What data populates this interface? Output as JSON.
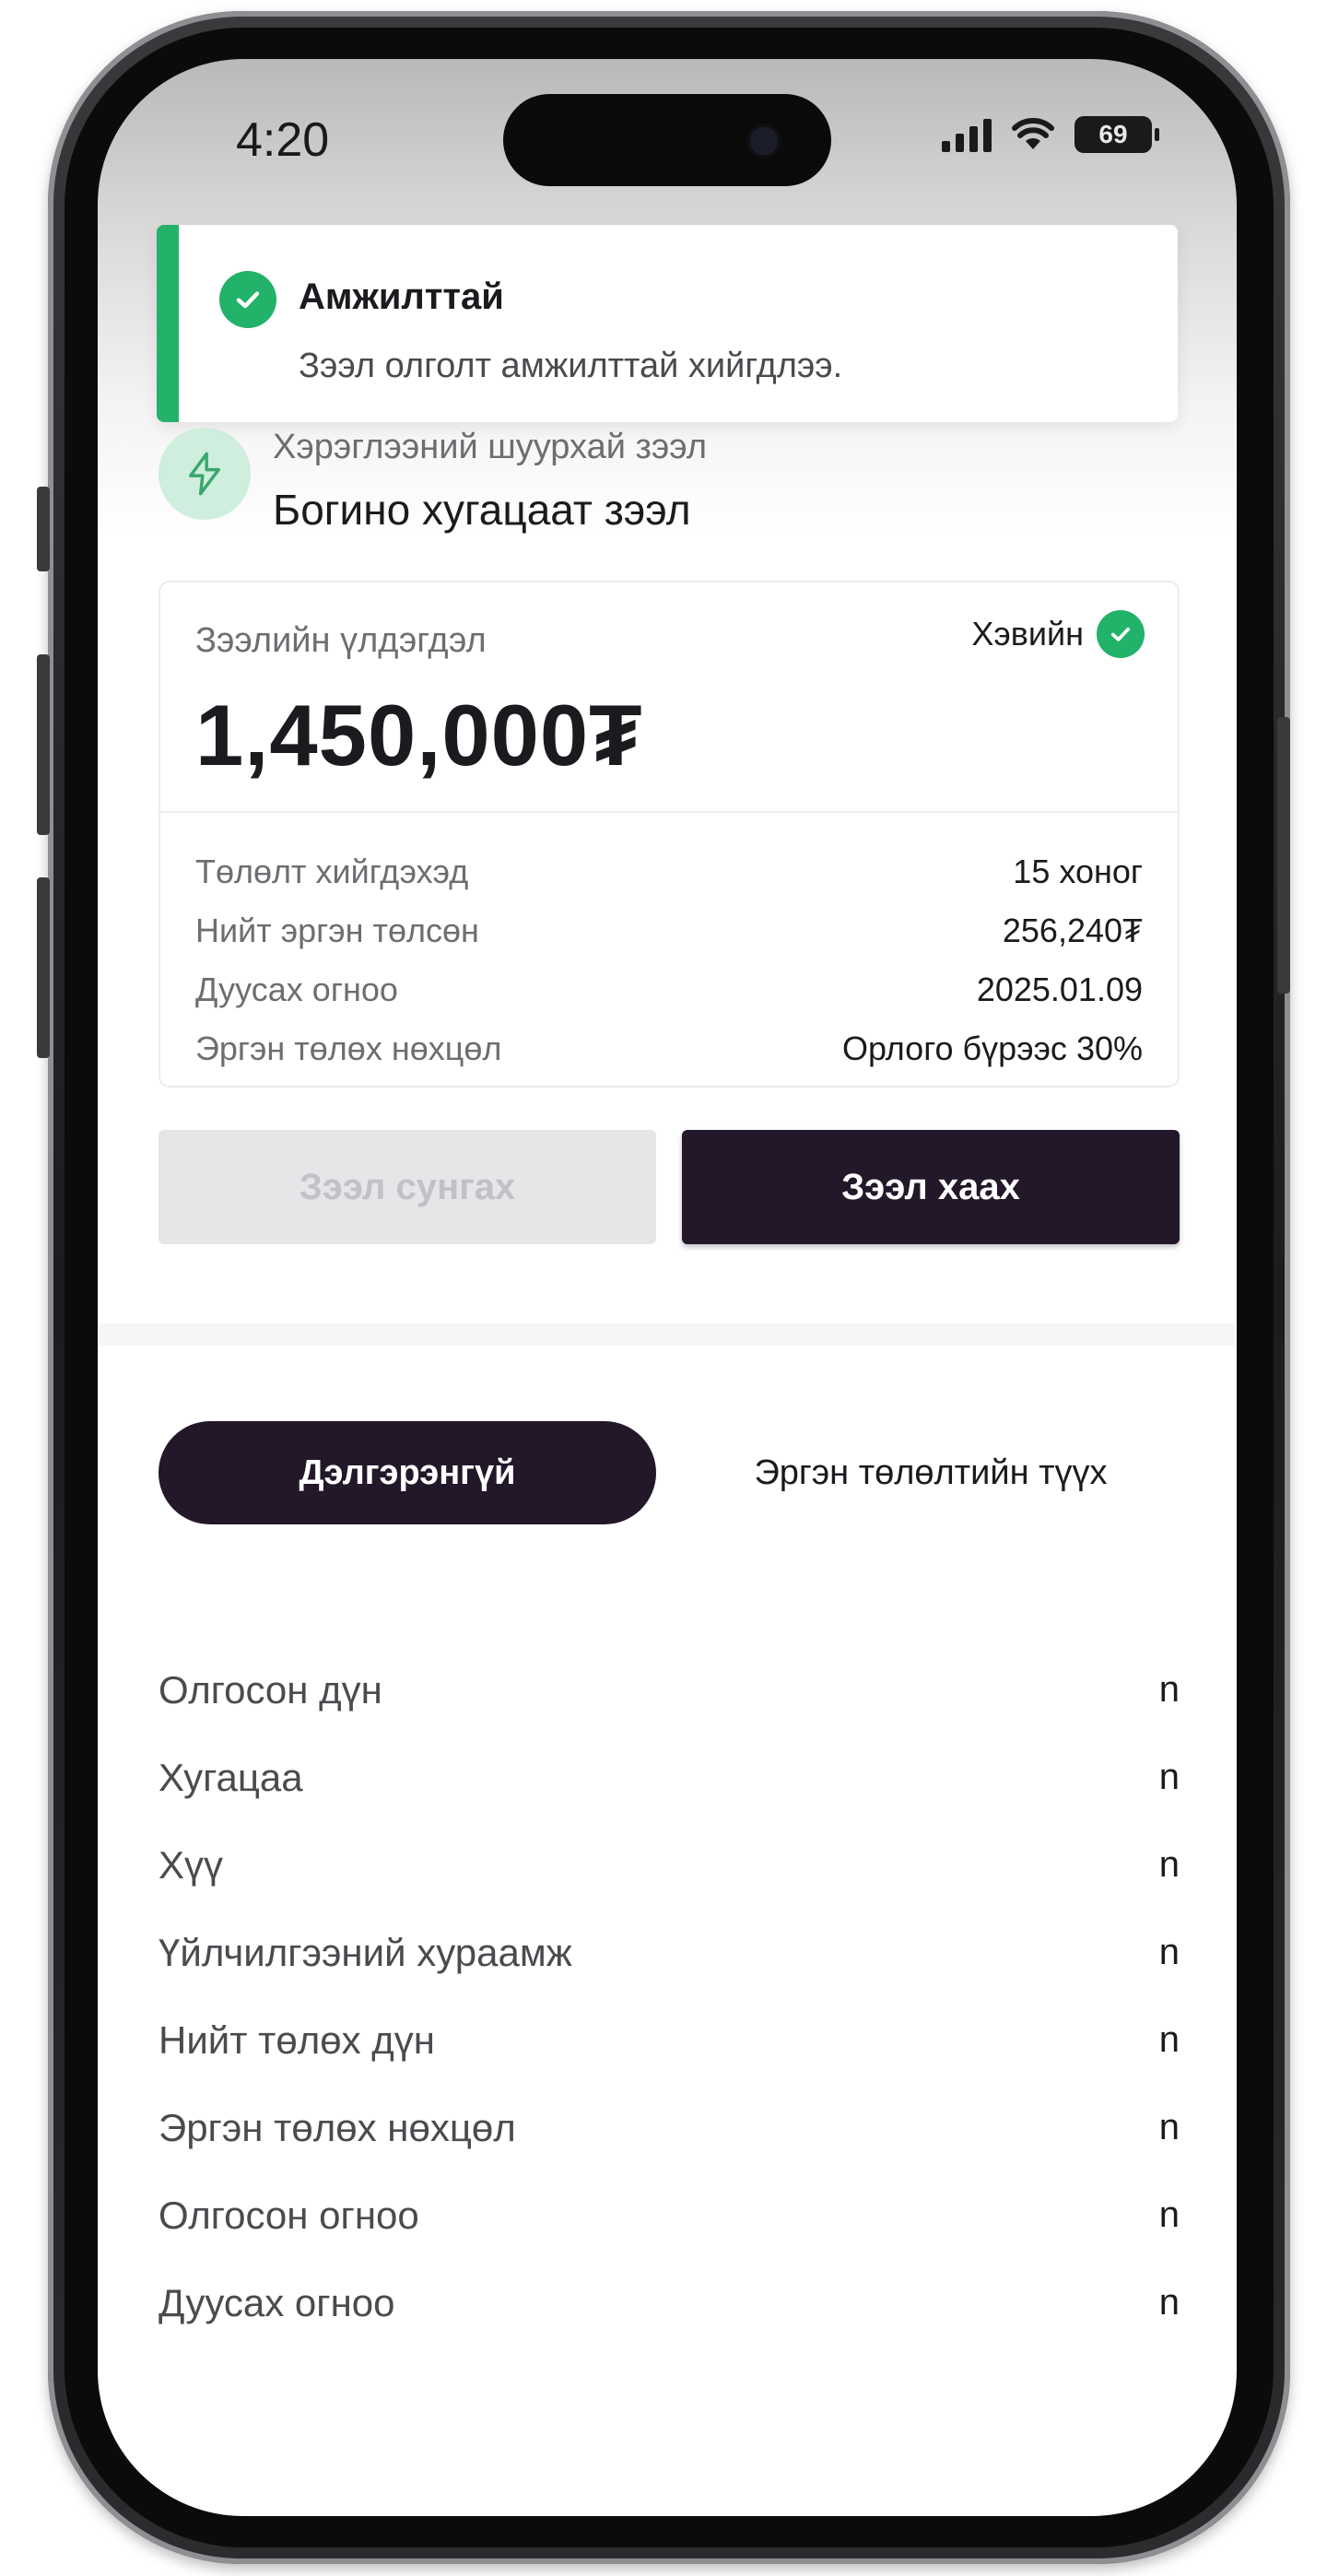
{
  "status_bar": {
    "time": "4:20",
    "battery": "69"
  },
  "toast": {
    "title": "Амжилттай",
    "message": "Зээл олголт амжилттай хийгдлээ."
  },
  "product": {
    "subtitle": "Хэрэглээний шуурхай зээл",
    "title": "Богино хугацаат зээл"
  },
  "loan_card": {
    "balance_label": "Зээлийн үлдэгдэл",
    "balance_amount": "1,450,000₮",
    "status": "Хэвийн",
    "details": [
      {
        "label": "Төлөлт хийгдэхэд",
        "value": "15 хоног"
      },
      {
        "label": "Нийт эргэн төлсөн",
        "value": "256,240₮"
      },
      {
        "label": "Дуусах огноо",
        "value": "2025.01.09"
      },
      {
        "label": "Эргэн төлөх нөхцөл",
        "value": "Орлого бүрээс 30%"
      }
    ]
  },
  "actions": {
    "extend_label": "Зээл сунгах",
    "close_label": "Зээл хаах"
  },
  "tabs": {
    "details_label": "Дэлгэрэнгүй",
    "history_label": "Эргэн төлөлтийн түүх"
  },
  "info_rows": [
    {
      "label": "Олгосон дүн",
      "value": "n"
    },
    {
      "label": "Хугацаа",
      "value": "n"
    },
    {
      "label": "Хүү",
      "value": "n"
    },
    {
      "label": "Үйлчилгээний хураамж",
      "value": "n"
    },
    {
      "label": "Нийт төлөх дүн",
      "value": "n"
    },
    {
      "label": "Эргэн төлөх нөхцөл",
      "value": "n"
    },
    {
      "label": "Олгосон огноо",
      "value": "n"
    },
    {
      "label": "Дуусах огноо",
      "value": "n"
    }
  ],
  "icons": {
    "toast": "check-circle-icon",
    "product": "lightning-icon",
    "status": "check-circle-icon",
    "signal": "cellular-signal-icon",
    "wifi": "wifi-icon",
    "battery": "battery-icon"
  },
  "colors": {
    "success": "#22b26a",
    "primary": "#23172a",
    "disabled_bg": "#e6e6e8",
    "disabled_text": "#c2c2c6"
  }
}
